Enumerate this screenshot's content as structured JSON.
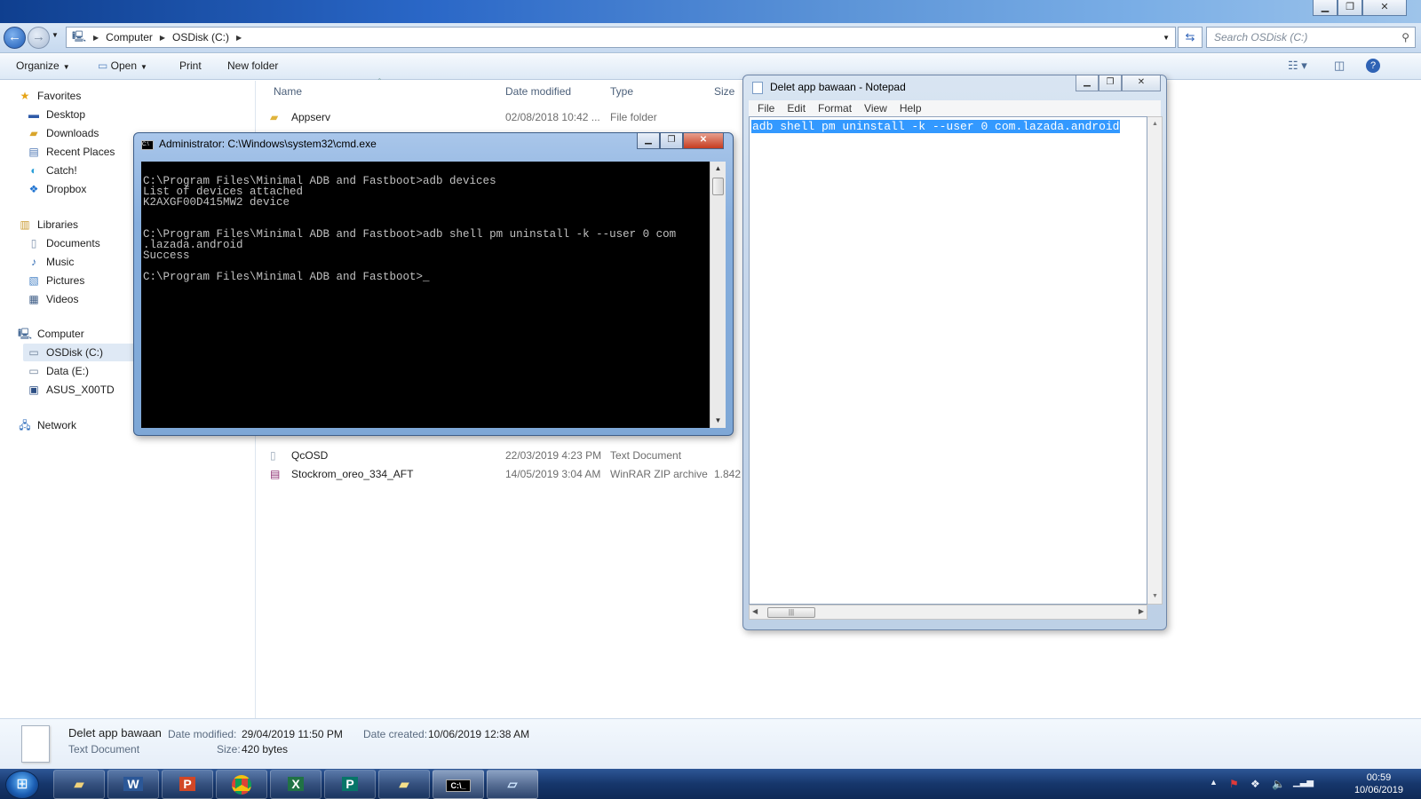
{
  "explorer": {
    "address": {
      "crumbs": [
        "Computer",
        "OSDisk (C:)"
      ]
    },
    "search_placeholder": "Search OSDisk (C:)",
    "toolbar": {
      "organize": "Organize",
      "open": "Open",
      "print": "Print",
      "new_folder": "New folder"
    },
    "nav": {
      "favorites_header": "Favorites",
      "favorites": [
        "Desktop",
        "Downloads",
        "Recent Places",
        "Catch!",
        "Dropbox"
      ],
      "libraries_header": "Libraries",
      "libraries": [
        "Documents",
        "Music",
        "Pictures",
        "Videos"
      ],
      "computer_header": "Computer",
      "computer": [
        "OSDisk (C:)",
        "Data (E:)",
        "ASUS_X00TD"
      ],
      "network": "Network"
    },
    "columns": {
      "name": "Name",
      "date": "Date modified",
      "type": "Type",
      "size": "Size"
    },
    "files": [
      {
        "name": "Appserv",
        "date": "02/08/2018 10:42 ...",
        "type": "File folder",
        "size": ""
      },
      {
        "name": "QcOSD",
        "date": "22/03/2019 4:23 PM",
        "type": "Text Document",
        "size": ""
      },
      {
        "name": "Stockrom_oreo_334_AFT",
        "date": "14/05/2019 3:04 AM",
        "type": "WinRAR ZIP archive",
        "size": "1.842"
      }
    ],
    "details": {
      "name": "Delet app bawaan",
      "type": "Text Document",
      "date_modified_label": "Date modified:",
      "date_modified": "29/04/2019 11:50 PM",
      "size_label": "Size:",
      "size": "420 bytes",
      "date_created_label": "Date created:",
      "date_created": "10/06/2019 12:38 AM"
    }
  },
  "cmd": {
    "title": "Administrator: C:\\Windows\\system32\\cmd.exe",
    "lines": [
      "",
      "C:\\Program Files\\Minimal ADB and Fastboot>adb devices",
      "List of devices attached",
      "K2AXGF00D415MW2 device",
      "",
      "",
      "C:\\Program Files\\Minimal ADB and Fastboot>adb shell pm uninstall -k --user 0 com",
      ".lazada.android",
      "Success",
      "",
      "C:\\Program Files\\Minimal ADB and Fastboot>_"
    ]
  },
  "notepad": {
    "title": "Delet app bawaan - Notepad",
    "menu": [
      "File",
      "Edit",
      "Format",
      "View",
      "Help"
    ],
    "content": "adb shell pm uninstall -k --user 0 com.lazada.android"
  },
  "taskbar": {
    "clock_time": "00:59",
    "clock_date": "10/06/2019",
    "buttons": [
      "explorer",
      "word",
      "powerpoint",
      "chrome",
      "excel",
      "publisher",
      "explorer-window",
      "cmd",
      "notepad"
    ]
  },
  "colors": {
    "accent": "#3399ff",
    "taskbar": "#16366b",
    "console_bg": "#000000",
    "console_fg": "#c0c0c0"
  }
}
